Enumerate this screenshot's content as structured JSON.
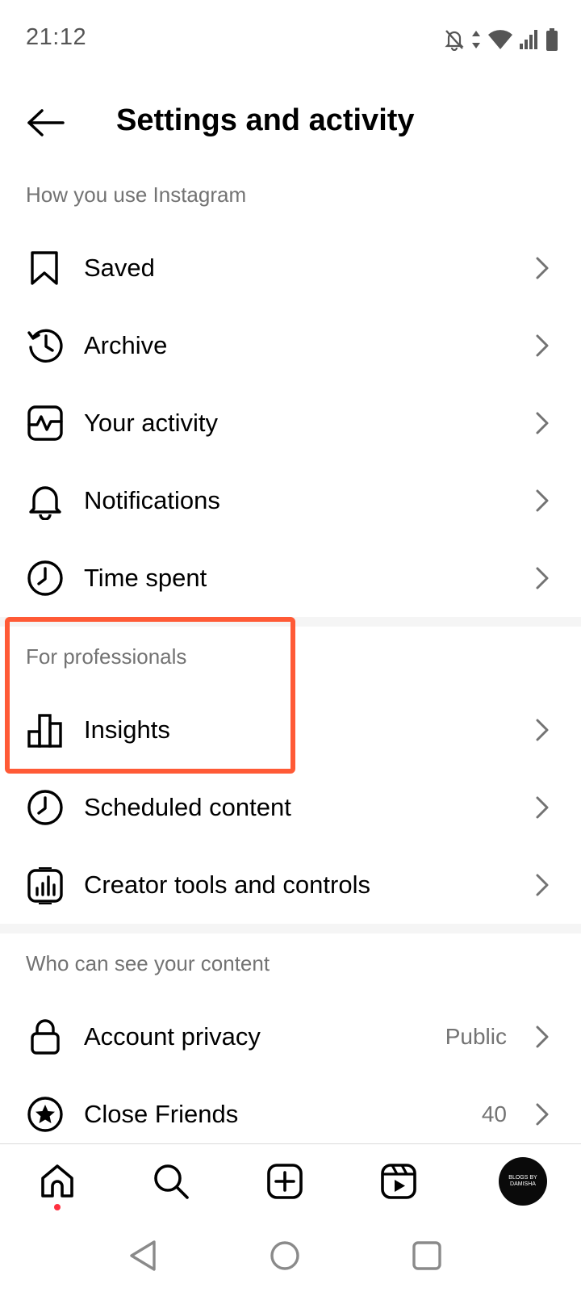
{
  "status_bar": {
    "time": "21:12",
    "icons": [
      "bell-off-icon",
      "data-arrows-icon",
      "wifi-icon",
      "signal-icon",
      "battery-icon"
    ]
  },
  "header": {
    "title": "Settings and activity"
  },
  "sections": {
    "usage": {
      "title": "How you use Instagram",
      "items": [
        {
          "label": "Saved",
          "icon": "bookmark-icon"
        },
        {
          "label": "Archive",
          "icon": "archive-icon"
        },
        {
          "label": "Your activity",
          "icon": "activity-icon"
        },
        {
          "label": "Notifications",
          "icon": "bell-icon"
        },
        {
          "label": "Time spent",
          "icon": "clock-icon"
        }
      ]
    },
    "professionals": {
      "title": "For professionals",
      "items": [
        {
          "label": "Insights",
          "icon": "bar-chart-icon"
        },
        {
          "label": "Scheduled content",
          "icon": "clock-icon"
        },
        {
          "label": "Creator tools and controls",
          "icon": "creator-tools-icon"
        }
      ]
    },
    "visibility": {
      "title": "Who can see your content",
      "items": [
        {
          "label": "Account privacy",
          "value": "Public",
          "icon": "lock-icon"
        },
        {
          "label": "Close Friends",
          "value": "40",
          "icon": "close-friends-star-icon"
        }
      ]
    }
  },
  "bottom_nav": {
    "items": [
      "home-icon",
      "search-icon",
      "create-icon",
      "reels-icon",
      "profile-avatar"
    ],
    "avatar_text": "BLOGS BY DAMISHA"
  },
  "colors": {
    "highlight": "#ff5a36",
    "secondary_text": "#737373",
    "notification_dot": "#ff3040"
  }
}
